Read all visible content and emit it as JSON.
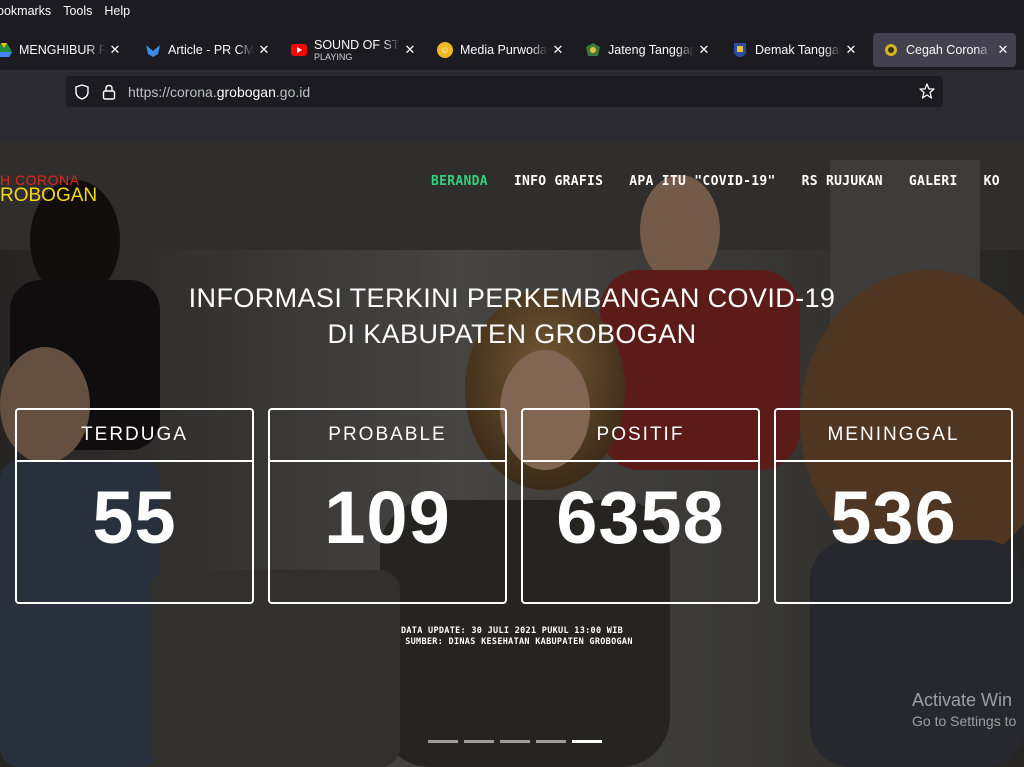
{
  "menubar": {
    "bookmarks": "ookmarks",
    "tools": "Tools",
    "help": "Help"
  },
  "tabs": [
    {
      "label": "MENGHIBUR PAS",
      "icon": "drive-icon",
      "color": "#2f9e44"
    },
    {
      "label": "Article - PR CMS",
      "icon": "bird-icon",
      "color": "#3b8ee8"
    },
    {
      "label": "SOUND OF STADI",
      "sub": "PLAYING",
      "icon": "youtube-icon",
      "color": "#ff0000"
    },
    {
      "label": "Media Purwodadi",
      "icon": "emoji-icon",
      "color": "#f2b824"
    },
    {
      "label": "Jateng Tanggap C",
      "icon": "crest-icon",
      "color": "#3d7a3a"
    },
    {
      "label": "Demak Tanggap",
      "icon": "crest-icon",
      "color": "#2a4fa0"
    },
    {
      "label": "Cegah Corona K",
      "icon": "globe-icon",
      "color": "#d6b21f"
    }
  ],
  "url": {
    "prefix": "https://corona.",
    "host": "grobogan",
    "suffix": ".go.id"
  },
  "logo": {
    "line1": "H CORONA",
    "line2": "ROBOGAN"
  },
  "nav": [
    "BERANDA",
    "INFO GRAFIS",
    "APA ITU \"COVID-19\"",
    "RS RUJUKAN",
    "GALERI",
    "KO"
  ],
  "headline": {
    "line1": "INFORMASI TERKINI PERKEMBANGAN COVID-19",
    "line2": "DI KABUPATEN GROBOGAN"
  },
  "stats": [
    {
      "label": "TERDUGA",
      "value": "55"
    },
    {
      "label": "PROBABLE",
      "value": "109"
    },
    {
      "label": "POSITIF",
      "value": "6358"
    },
    {
      "label": "MENINGGAL",
      "value": "536"
    }
  ],
  "update": {
    "line1": "DATA UPDATE: 30 JULI 2021 PUKUL 13:00 WIB",
    "line2": "SUMBER: DINAS KESEHATAN KABUPATEN GROBOGAN"
  },
  "watermark": {
    "line1": "Activate Win",
    "line2": "Go to Settings to"
  }
}
